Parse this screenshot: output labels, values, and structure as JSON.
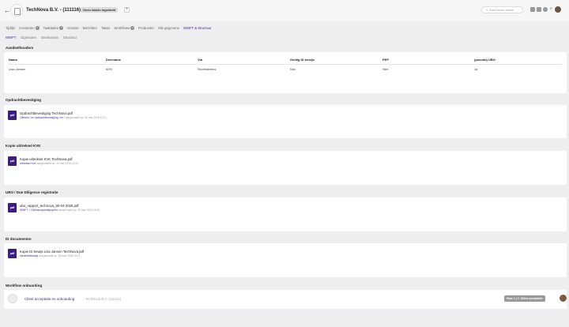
{
  "header": {
    "back_glyph": "←",
    "title": "TechNova B.V. - (111116)",
    "label_badge": "Geen labels ingesteld",
    "add_label": "+",
    "search_icon": "⌕",
    "search_placeholder": "Zoek binnen relatie"
  },
  "tabs": [
    {
      "label": "Tijdlijn",
      "count": null
    },
    {
      "label": "Contacten",
      "count": "3"
    },
    {
      "label": "Taakladen",
      "count": "6"
    },
    {
      "label": "Dossier",
      "count": null
    },
    {
      "label": "Berichten",
      "count": null
    },
    {
      "label": "Taken",
      "count": null
    },
    {
      "label": "Workflows",
      "count": "2"
    },
    {
      "label": "Producten",
      "count": null
    },
    {
      "label": "Alle gegevens",
      "count": null
    },
    {
      "label": "WWFT & Structuur",
      "count": null,
      "active": true
    }
  ],
  "subtabs": [
    {
      "label": "WWFT",
      "active": true
    },
    {
      "label": "Eigenaren"
    },
    {
      "label": "Deelnames"
    },
    {
      "label": "Structuur"
    }
  ],
  "shareholders": {
    "title": "Aandeelhouders",
    "columns": [
      "Naam",
      "Deelname",
      "Via",
      "Geldig ID bewijs",
      "PEP",
      "(pseudo) UBO"
    ],
    "rows": [
      [
        "Lisa Jansen",
        "60%",
        "Rechtstreeks",
        "Nee",
        "Nee",
        "Ja"
      ]
    ]
  },
  "documents": [
    {
      "section": "Opdrachtbevestiging",
      "icon": "pdf",
      "name": "Opdrachtbevestiging TechNova.pdf",
      "path": "Offertes / en opdrachtbevestiging / en /",
      "meta": "aangemaakt op: 30 mar 2026 13:21"
    },
    {
      "section": "Kopie uittreksel KVK",
      "icon": "pdf",
      "name": "Kopie uittreksel KVK TechNova.pdf",
      "path": "Uittreksel KvK",
      "meta": "aangemaakt op: 30 mar 2026 13:20"
    },
    {
      "section": "UBO / Due Diligence registratie",
      "icon": "pdf",
      "name": "ubo_rapport_technova_30-04-2026.pdf",
      "path": "WWFT > Cliëntacceptatiepsynes",
      "meta": "aangemaakt op: 30 mar 2026 13:45"
    },
    {
      "section": "ID documenten",
      "icon": "pdf",
      "name": "Kopie ID bewijs Lisa Jansen TechNova.pdf",
      "path": "Identiteitsbewijs",
      "meta": "aangemaakt op: 30 mar 2026 13:21"
    }
  ],
  "workflow": {
    "section": "Workflow onboarding",
    "title": "Cliënt acceptatie en onboarding",
    "company": "TechNova B.V. (111116)",
    "phase": "Fase 1 | 1. Cliënt acceptatie"
  }
}
